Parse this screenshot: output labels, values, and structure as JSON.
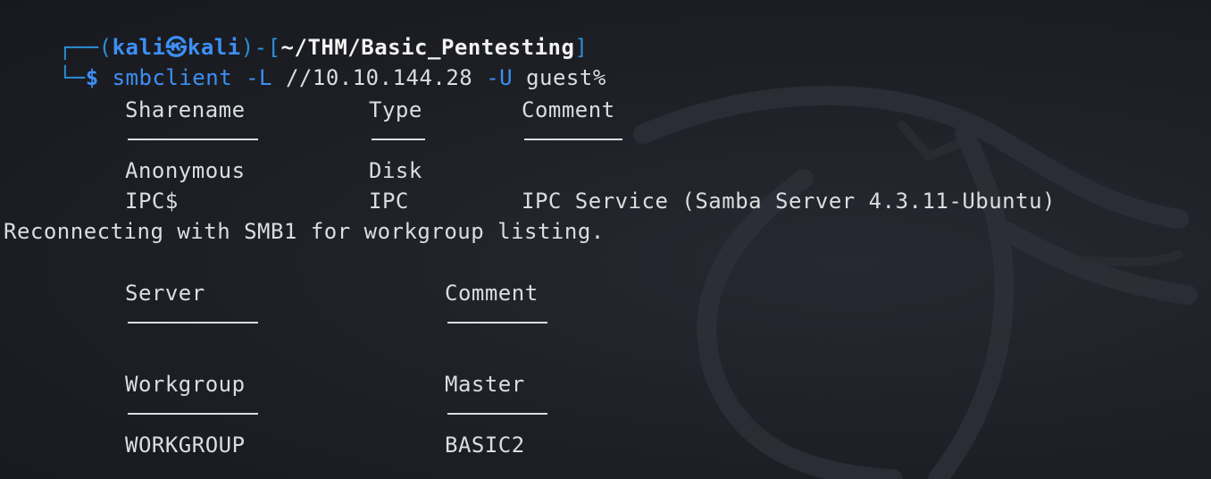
{
  "prompt": {
    "frame_open": "┌──(",
    "user": "kali",
    "skull": "㉿",
    "host": "kali",
    "frame_mid": ")-[",
    "path": "~/THM/Basic_Pentesting",
    "frame_close": "]",
    "frame_bottom": "└─",
    "dollar": "$"
  },
  "command": {
    "program": "smbclient",
    "flag_list": "-L",
    "target": "//10.10.144.28",
    "flag_user": "-U",
    "user_value": "guest%"
  },
  "shares_table": {
    "headers": [
      "Sharename",
      "Type",
      "Comment"
    ],
    "rows": [
      [
        "Anonymous",
        "Disk",
        ""
      ],
      [
        "IPC$",
        "IPC",
        "IPC Service (Samba Server 4.3.11-Ubuntu)"
      ]
    ]
  },
  "reconnect_message": "Reconnecting with SMB1 for workgroup listing.",
  "server_table": {
    "headers": [
      "Server",
      "Comment"
    ],
    "rows": []
  },
  "workgroup_table": {
    "headers": [
      "Workgroup",
      "Master"
    ],
    "rows": [
      [
        "WORKGROUP",
        "BASIC2"
      ]
    ]
  },
  "colors": {
    "background": "#1c1e24",
    "prompt_blue": "#3d8ff5",
    "frame_blue": "#2b8fd6",
    "text": "#dcdde0"
  }
}
